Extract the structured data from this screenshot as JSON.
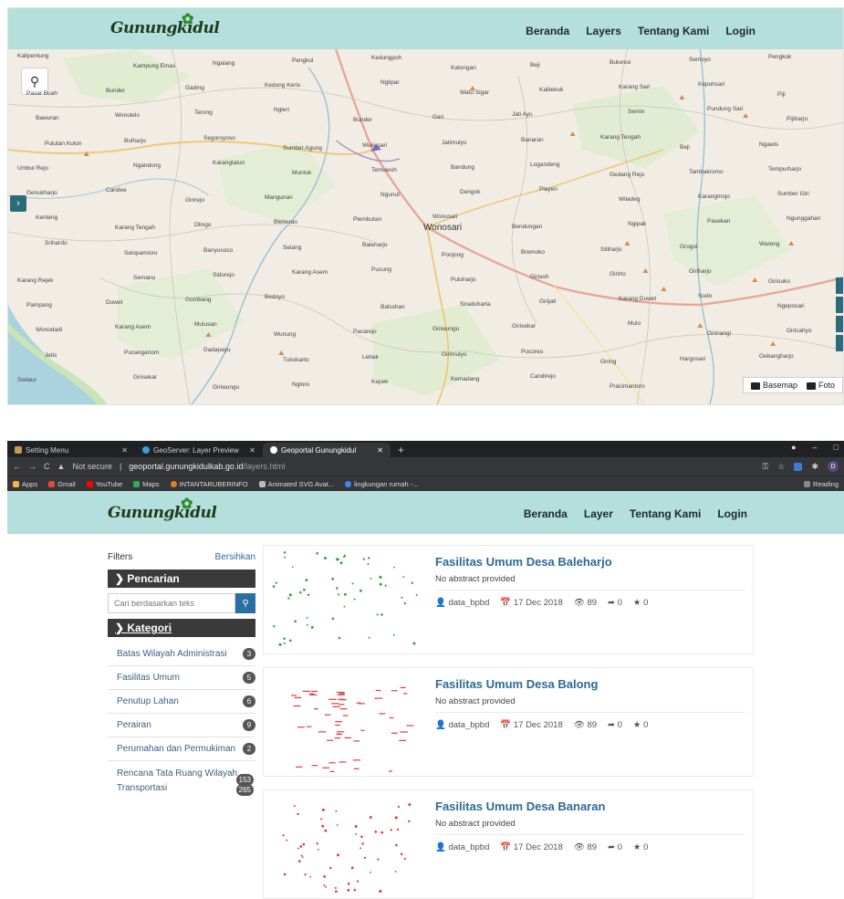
{
  "top_site": {
    "logo_text": "Gunungkidul",
    "nav": [
      "Beranda",
      "Layers",
      "Tentang Kami",
      "Login"
    ],
    "map": {
      "labels_main": [
        "Wonosari"
      ],
      "labels": [
        "Kalipentung",
        "Kampung Emas",
        "Ngalang",
        "Pengkol",
        "Kedungpoh",
        "Katongan",
        "Beji",
        "Buluresi",
        "Semoyo",
        "Pengkok",
        "Pasar Buah",
        "Bunder",
        "Gading",
        "Kedung Keris",
        "Nglipar",
        "Watu Sigar",
        "Kalitekuk",
        "Karang Sari",
        "Kepuhsari",
        "Piji",
        "Bawuran",
        "Wonolelo",
        "Terong",
        "Ngleri",
        "Bunder",
        "Gari",
        "Jati Ayu",
        "Semin",
        "Pundung Sari",
        "Pijiharjo",
        "Pulutan Kulon",
        "Bulharjo",
        "Segoroyoso",
        "Sumber Agung",
        "Wukirsari",
        "Jatimulyo",
        "Banaran",
        "Karang Tengah",
        "Beji",
        "Ngawis",
        "Umbul Rejo",
        "Ngandong",
        "Karangtalun",
        "Muntuk",
        "Temuwuh",
        "Bandung",
        "Logandeng",
        "Gedang Rejo",
        "Tambakromo",
        "Tempurharjo",
        "Genukharjo",
        "Candee",
        "Girirejo",
        "Mangunan",
        "Ngunut",
        "Dengok",
        "Playen",
        "Wiladeg",
        "Karangmojo",
        "Sumber Giri",
        "Kenteng",
        "Karang Tengah",
        "Dlingo",
        "Bleberan",
        "Plembutan",
        "Wonosari",
        "Bendungan",
        "Ngipak",
        "Pasekan",
        "Ngunggahan",
        "Srihardo",
        "Selopamioro",
        "Banyusoco",
        "Selang",
        "Baleharjo",
        "Ponjong",
        "Bremoko",
        "Sitiharjo",
        "Grogol",
        "Wareng",
        "Karang Rejek",
        "Semanu",
        "Sidorejo",
        "Karang Asem",
        "Pucung",
        "Puloharjo",
        "Giriash",
        "Girirto",
        "Giriharjo",
        "Girisuko",
        "Pampang",
        "Duwet",
        "Gombang",
        "Bedoyo",
        "Balsshan",
        "Siraduharta",
        "Girijati",
        "Karang Duwet",
        "Sodo",
        "Ngeposari",
        "Wonodadi",
        "Karang Asem",
        "Mulusan",
        "Wunung",
        "Pacarejo",
        "Giriwungu",
        "Girisekar",
        "Mulo",
        "Girinangi",
        "Giricahyo",
        "Jetis",
        "Pucanganom",
        "Dadapayu",
        "Tukokarto",
        "Lebak",
        "Girimulyo",
        "Pocoreo",
        "Giring",
        "Hargosari",
        "Gebangharjo",
        "Sedaur",
        "Girisekar",
        "Giriwungu",
        "Ngloro",
        "Kepek",
        "Kemadang",
        "Candirejo",
        "Pracimantoro"
      ],
      "zoom_icon": "search-icon",
      "toggle_icon": "chevron-right-icon",
      "controls": [
        "Basemap",
        "Foto"
      ]
    }
  },
  "browser": {
    "tabs": [
      {
        "label": "Setting Menu",
        "icon": "setting-icon"
      },
      {
        "label": "GeoServer: Layer Preview",
        "icon": "geoserver-icon"
      },
      {
        "label": "Geoportal Gunungkidul",
        "icon": "geoportal-icon"
      }
    ],
    "new_tab": "+",
    "window_controls": [
      "–",
      "□"
    ],
    "address": {
      "security": "Not secure",
      "separator": "|",
      "host": "geoportal.gunungkidulkab.go.id",
      "path": "/layers.html",
      "profile_initial": "D"
    },
    "bookmarks": [
      "Apps",
      "Gmail",
      "YouTube",
      "Maps",
      "INTANTARUBERINFO",
      "Animated SVG Avat...",
      "lingkungan rumah -..."
    ],
    "reading_list": "Reading"
  },
  "site": {
    "logo_text": "Gunungkidul",
    "nav": [
      "Beranda",
      "Layer",
      "Tentang Kami",
      "Login"
    ]
  },
  "filters": {
    "title": "Filters",
    "clear": "Bersihkan",
    "search_section": "Pencarian",
    "search_placeholder": "Cari berdasarkan teks",
    "category_section": "Kategori",
    "categories": [
      {
        "label": "Batas Wilayah Administrasi",
        "count": "3"
      },
      {
        "label": "Fasilitas Umum",
        "count": "5"
      },
      {
        "label": "Penutup Lahan",
        "count": "6"
      },
      {
        "label": "Perairan",
        "count": "9"
      },
      {
        "label": "Perumahan dan Permukiman",
        "count": "2"
      }
    ],
    "extra_categories": [
      "Rencana Tata Ruang Wilayah",
      "Transportasi"
    ],
    "extra_counts": [
      "153",
      "265"
    ]
  },
  "layers": [
    {
      "title": "Fasilitas Umum Desa Baleharjo",
      "abstract": "No abstract provided",
      "owner": "data_bpbd",
      "date": "17 Dec 2018",
      "views": "89",
      "shares": "0",
      "rating": "0",
      "thumb_color": "#3aa53a"
    },
    {
      "title": "Fasilitas Umum Desa Balong",
      "abstract": "No abstract provided",
      "owner": "data_bpbd",
      "date": "17 Dec 2018",
      "views": "89",
      "shares": "0",
      "rating": "0",
      "thumb_color": "#e33b3b"
    },
    {
      "title": "Fasilitas Umum Desa Banaran",
      "abstract": "No abstract provided",
      "owner": "data_bpbd",
      "date": "17 Dec 2018",
      "views": "89",
      "shares": "0",
      "rating": "0",
      "thumb_color": "#e33b3b"
    }
  ],
  "colors": {
    "header_teal": "#b4dfdc",
    "link_blue": "#2d6a96",
    "dark": "#3a3a3a"
  }
}
